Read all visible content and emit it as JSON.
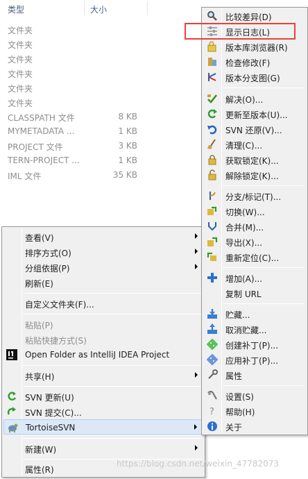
{
  "explorer": {
    "columns": {
      "type": "类型",
      "size": "大小"
    },
    "files": [
      {
        "type": "文件夹",
        "size": ""
      },
      {
        "type": "文件夹",
        "size": ""
      },
      {
        "type": "文件夹",
        "size": ""
      },
      {
        "type": "文件夹",
        "size": ""
      },
      {
        "type": "文件夹",
        "size": ""
      },
      {
        "type": "文件夹",
        "size": ""
      },
      {
        "type": "CLASSPATH 文件",
        "size": "8 KB"
      },
      {
        "type": "MYMETADATA ...",
        "size": "1 KB"
      },
      {
        "type": "PROJECT 文件",
        "size": "3 KB"
      },
      {
        "type": "TERN-PROJECT ...",
        "size": "1 KB"
      },
      {
        "type": "IML 文件",
        "size": "35 KB"
      }
    ]
  },
  "context_menu": {
    "items": [
      {
        "label": "查看(V)",
        "icon": "",
        "submenu": true
      },
      {
        "label": "排序方式(O)",
        "icon": "",
        "submenu": true
      },
      {
        "label": "分组依据(P)",
        "icon": "",
        "submenu": true
      },
      {
        "label": "刷新(E)",
        "icon": ""
      },
      {
        "label": "自定义文件夹(F)...",
        "icon": ""
      },
      {
        "label": "粘贴(P)",
        "icon": "",
        "disabled": true
      },
      {
        "label": "粘贴快捷方式(S)",
        "icon": "",
        "disabled": true
      },
      {
        "label": "Open Folder as IntelliJ IDEA Project",
        "icon": "intellij-icon"
      },
      {
        "label": "共享(H)",
        "icon": "",
        "submenu": true
      },
      {
        "label": "SVN 更新(U)",
        "icon": "svn-update-icon"
      },
      {
        "label": "SVN 提交(C)...",
        "icon": "svn-commit-icon"
      },
      {
        "label": "TortoiseSVN",
        "icon": "tortoisesvn-icon",
        "submenu": true,
        "highlighted": true
      },
      {
        "label": "新建(W)",
        "icon": "",
        "submenu": true
      },
      {
        "label": "属性(R)",
        "icon": ""
      }
    ]
  },
  "svn_submenu": {
    "items": [
      {
        "label": "比较差异(D)",
        "icon": "diff-icon"
      },
      {
        "label": "显示日志(L)",
        "icon": "show-log-icon",
        "annotated": true
      },
      {
        "label": "版本库浏览器(R)",
        "icon": "repo-browser-icon"
      },
      {
        "label": "检查修改(F)",
        "icon": "check-modifications-icon"
      },
      {
        "label": "版本分支图(G)",
        "icon": "revision-graph-icon"
      },
      {
        "label": "解决(O)...",
        "icon": "resolve-icon"
      },
      {
        "label": "更新至版本(U)...",
        "icon": "update-to-revision-icon"
      },
      {
        "label": "SVN 还原(V)...",
        "icon": "revert-icon"
      },
      {
        "label": "清理(C)...",
        "icon": "cleanup-icon"
      },
      {
        "label": "获取锁定(K)...",
        "icon": "lock-icon"
      },
      {
        "label": "解除锁定(K)...",
        "icon": "unlock-icon"
      },
      {
        "label": "分支/标记(T)...",
        "icon": "branch-tag-icon"
      },
      {
        "label": "切换(W)...",
        "icon": "switch-icon"
      },
      {
        "label": "合并(M)...",
        "icon": "merge-icon"
      },
      {
        "label": "导出(X)...",
        "icon": "export-icon"
      },
      {
        "label": "重新定位(C)...",
        "icon": "relocate-icon"
      },
      {
        "label": "增加(A)...",
        "icon": "add-icon"
      },
      {
        "label": "复制 URL",
        "icon": "copy-url-icon"
      },
      {
        "label": "贮藏...",
        "icon": "shelve-icon"
      },
      {
        "label": "取消贮藏...",
        "icon": "unshelve-icon"
      },
      {
        "label": "创建补丁(P)...",
        "icon": "create-patch-icon"
      },
      {
        "label": "应用补丁(P)...",
        "icon": "apply-patch-icon"
      },
      {
        "label": "属性",
        "icon": "properties-icon"
      },
      {
        "label": "设置(S)",
        "icon": "settings-icon"
      },
      {
        "label": "帮助(H)",
        "icon": "help-icon"
      },
      {
        "label": "关于",
        "icon": "about-icon"
      }
    ]
  },
  "watermark": "https://blog.csdn.net/weixin_47782073",
  "colors": {
    "highlight": "#dde8f6",
    "annotation": "#e8403a",
    "menu_bg": "#f0f0f0"
  }
}
